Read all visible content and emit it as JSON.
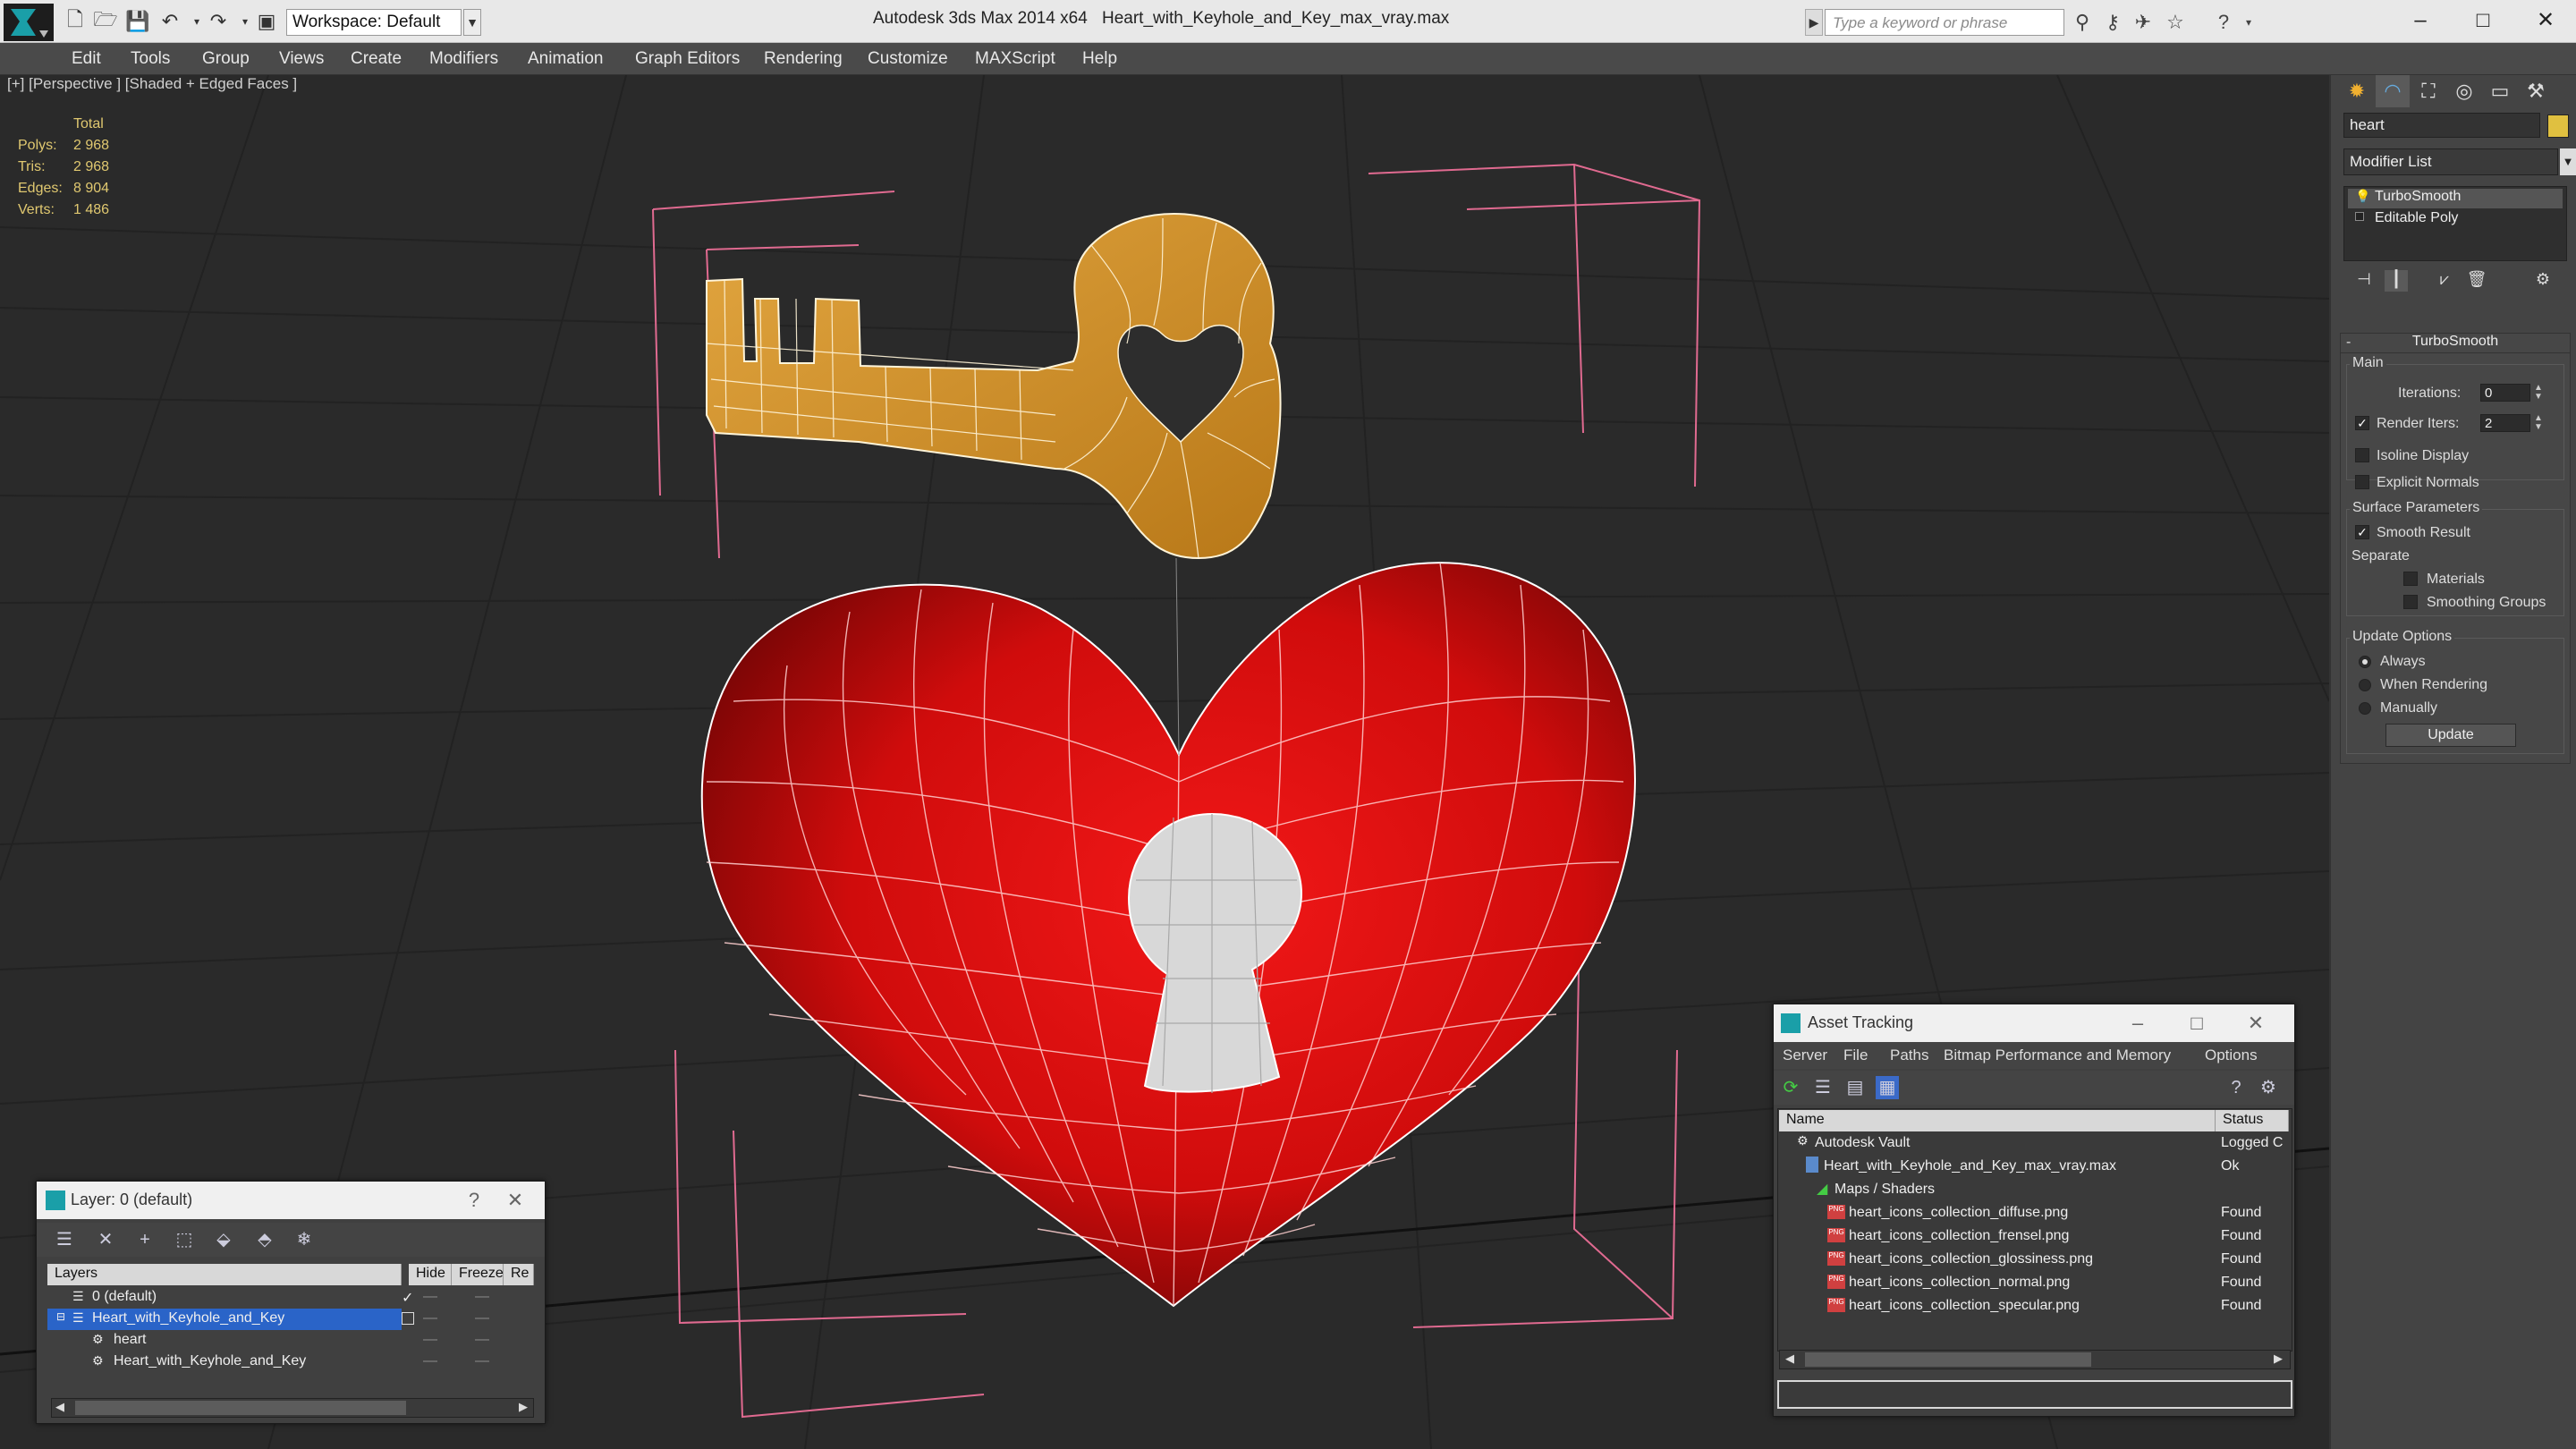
{
  "app": {
    "app_title": "Autodesk 3ds Max  2014 x64",
    "file_title": "Heart_with_Keyhole_and_Key_max_vray.max",
    "workspace": "Workspace: Default",
    "search_placeholder": "Type a keyword or phrase",
    "minimize": "–",
    "maximize": "□",
    "close": "✕"
  },
  "menu": [
    "Edit",
    "Tools",
    "Group",
    "Views",
    "Create",
    "Modifiers",
    "Animation",
    "Graph Editors",
    "Rendering",
    "Customize",
    "MAXScript",
    "Help"
  ],
  "viewport": {
    "label": "[+] [Perspective ] [Shaded + Edged Faces ]",
    "stats_header": "Total",
    "stats": [
      {
        "label": "Polys:",
        "value": "2 968"
      },
      {
        "label": "Tris:",
        "value": "2 968"
      },
      {
        "label": "Edges:",
        "value": "8 904"
      },
      {
        "label": "Verts:",
        "value": "1 486"
      }
    ]
  },
  "command_panel": {
    "object_name": "heart",
    "object_color": "#e0c040",
    "modifier_list": "Modifier List",
    "stack": [
      "TurboSmooth",
      "Editable Poly"
    ],
    "rollout_title": "TurboSmooth",
    "main_group": "Main",
    "iterations_label": "Iterations:",
    "iterations_value": "0",
    "render_iters_label": "Render Iters:",
    "render_iters_value": "2",
    "isoline_display": "Isoline Display",
    "explicit_normals": "Explicit Normals",
    "surface_params": "Surface Parameters",
    "smooth_result": "Smooth Result",
    "separate": "Separate",
    "materials": "Materials",
    "smoothing_groups": "Smoothing Groups",
    "update_options": "Update Options",
    "always": "Always",
    "when_rendering": "When Rendering",
    "manually": "Manually",
    "update_button": "Update"
  },
  "layer_window": {
    "title": "Layer: 0 (default)",
    "help": "?",
    "close": "✕",
    "col_layers": "Layers",
    "col_hide": "Hide",
    "col_freeze": "Freeze",
    "col_render": "Re",
    "rows": [
      {
        "name": "0 (default)"
      },
      {
        "name": "Heart_with_Keyhole_and_Key"
      },
      {
        "name": "heart"
      },
      {
        "name": "Heart_with_Keyhole_and_Key"
      }
    ]
  },
  "asset_window": {
    "title": "Asset Tracking",
    "menus": [
      "Server",
      "File",
      "Paths",
      "Bitmap Performance and Memory",
      "Options"
    ],
    "col_name": "Name",
    "col_status": "Status",
    "rows": [
      {
        "name": "Autodesk Vault",
        "status": "Logged C"
      },
      {
        "name": "Heart_with_Keyhole_and_Key_max_vray.max",
        "status": "Ok"
      },
      {
        "name": "Maps / Shaders",
        "status": ""
      },
      {
        "name": "heart_icons_collection_diffuse.png",
        "status": "Found"
      },
      {
        "name": "heart_icons_collection_frensel.png",
        "status": "Found"
      },
      {
        "name": "heart_icons_collection_glossiness.png",
        "status": "Found"
      },
      {
        "name": "heart_icons_collection_normal.png",
        "status": "Found"
      },
      {
        "name": "heart_icons_collection_specular.png",
        "status": "Found"
      }
    ]
  }
}
